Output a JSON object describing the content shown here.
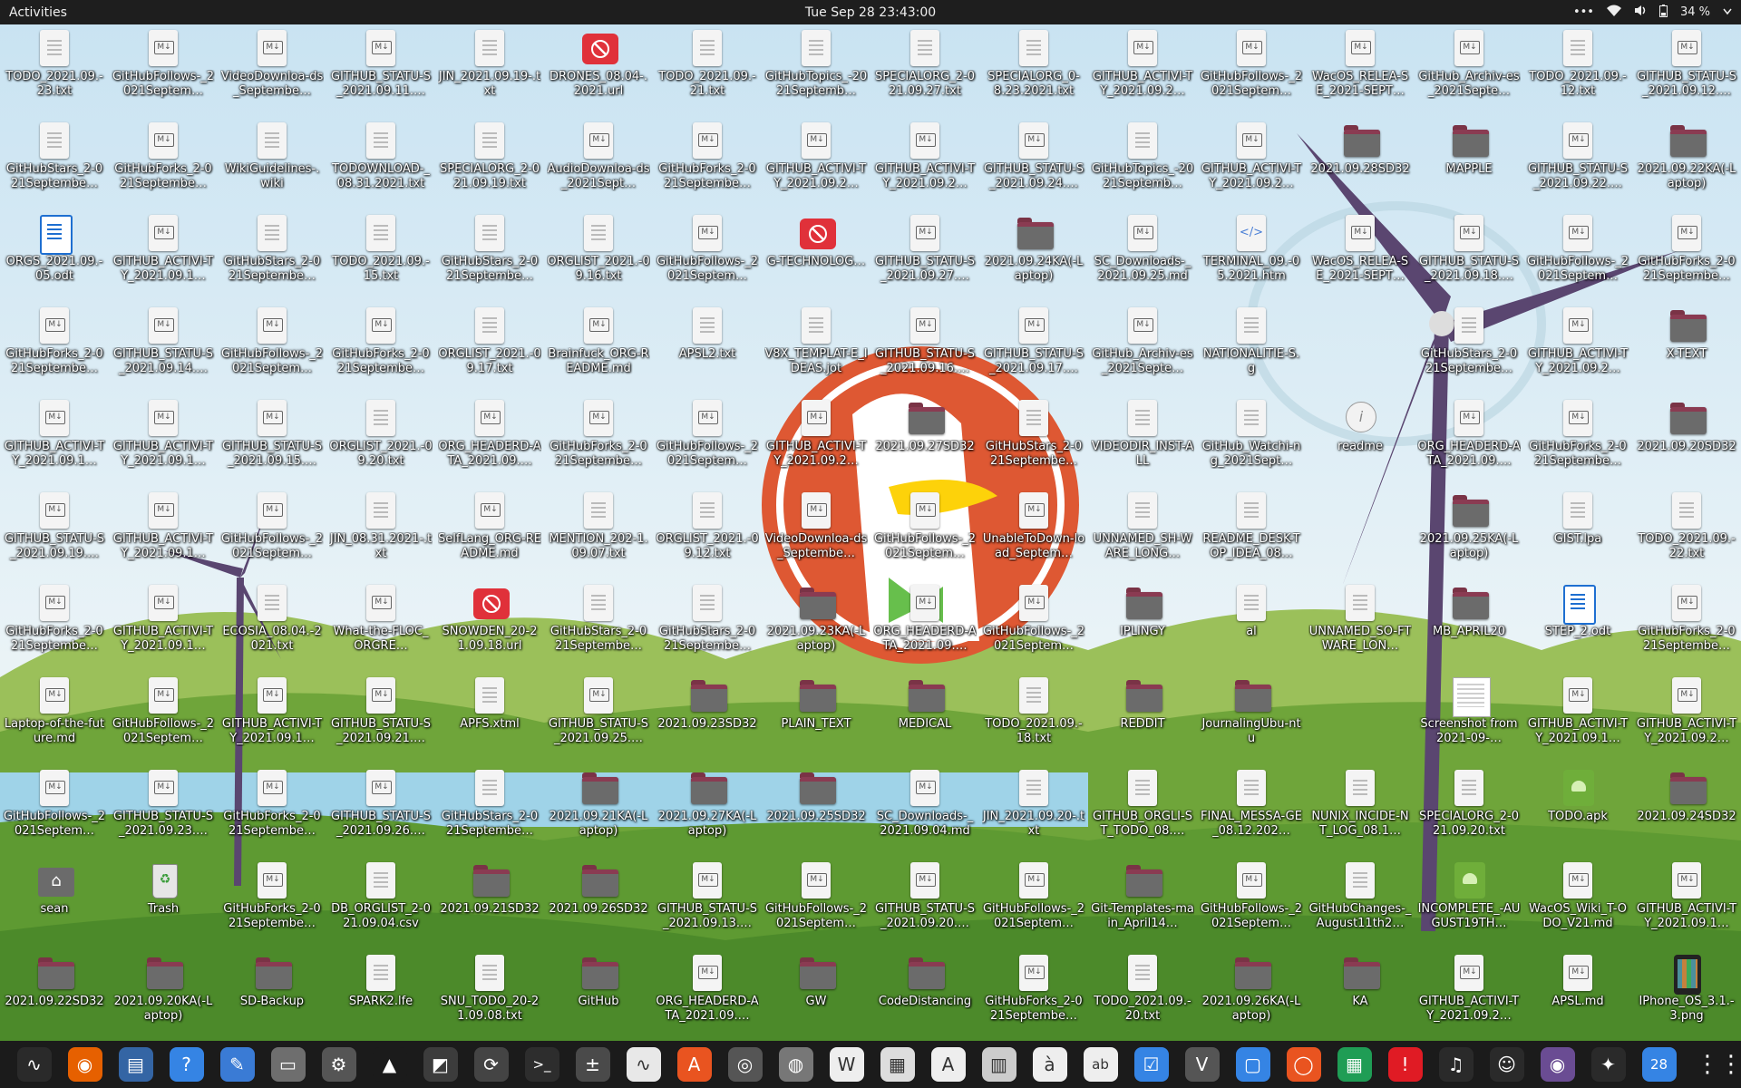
{
  "topbar": {
    "activities": "Activities",
    "clock": "Tue Sep 28  23:43:00",
    "menu_dots": "•••",
    "battery": "34 %",
    "icons": [
      "network-wifi-icon",
      "volume-icon",
      "battery-icon",
      "power-menu-icon"
    ]
  },
  "desktop": {
    "items": [
      {
        "label": "TODO_2021.09.-23.txt",
        "icon": "txt"
      },
      {
        "label": "GitHubFollows-_2021Septem…",
        "icon": "md"
      },
      {
        "label": "VideoDownloa-ds_Septembe…",
        "icon": "md"
      },
      {
        "label": "GITHUB_STATU-S_2021.09.11.…",
        "icon": "md"
      },
      {
        "label": "JIN_2021.09.19-.txt",
        "icon": "txt"
      },
      {
        "label": "DRONES_08.04-.2021.url",
        "icon": "url"
      },
      {
        "label": "TODO_2021.09.-21.txt",
        "icon": "txt"
      },
      {
        "label": "GitHubTopics_-2021Septemb…",
        "icon": "txt"
      },
      {
        "label": "SPECIALORG_2-021.09.27.txt",
        "icon": "txt"
      },
      {
        "label": "SPECIALORG_0-8.23.2021.txt",
        "icon": "txt"
      },
      {
        "label": "GITHUB_ACTIVI-TY_2021.09.2…",
        "icon": "md"
      },
      {
        "label": "GitHubFollows-_2021Septem…",
        "icon": "md"
      },
      {
        "label": "WacOS_RELEA-SE_2021-SEPT…",
        "icon": "md"
      },
      {
        "label": "GitHub_Archiv-es_2021Septe…",
        "icon": "md"
      },
      {
        "label": "TODO_2021.09.-12.txt",
        "icon": "txt"
      },
      {
        "label": "GITHUB_STATU-S_2021.09.12.…",
        "icon": "md"
      },
      {
        "label": "GitHubStars_2-021Septembe…",
        "icon": "txt"
      },
      {
        "label": "GitHubForks_2-021Septembe…",
        "icon": "md"
      },
      {
        "label": "WikiGuidelines-.wiki",
        "icon": "txt"
      },
      {
        "label": "TODOWNLOAD-_08.31.2021.txt",
        "icon": "txt"
      },
      {
        "label": "SPECIALORG_2-021.09.19.txt",
        "icon": "txt"
      },
      {
        "label": "AudioDownloa-ds_2021Sept…",
        "icon": "md"
      },
      {
        "label": "GitHubForks_2-021Septembe…",
        "icon": "md"
      },
      {
        "label": "GITHUB_ACTIVI-TY_2021.09.2…",
        "icon": "md"
      },
      {
        "label": "GITHUB_ACTIVI-TY_2021.09.2…",
        "icon": "md"
      },
      {
        "label": "GITHUB_STATU-S_2021.09.24.…",
        "icon": "md"
      },
      {
        "label": "GitHubTopics_-2021Septemb…",
        "icon": "txt"
      },
      {
        "label": "GITHUB_ACTIVI-TY_2021.09.2…",
        "icon": "md"
      },
      {
        "label": "2021.09.28SD32",
        "icon": "folder"
      },
      {
        "label": "MAPPLE",
        "icon": "folder"
      },
      {
        "label": "GITHUB_STATU-S_2021.09.22.…",
        "icon": "md"
      },
      {
        "label": "2021.09.22KA(-Laptop)",
        "icon": "folder"
      },
      {
        "label": "ORGS_2021.09.-05.odt",
        "icon": "odt"
      },
      {
        "label": "GITHUB_ACTIVI-TY_2021.09.1…",
        "icon": "md"
      },
      {
        "label": "GitHubStars_2-021Septembe…",
        "icon": "txt"
      },
      {
        "label": "TODO_2021.09.-15.txt",
        "icon": "txt"
      },
      {
        "label": "GitHubStars_2-021Septembe…",
        "icon": "txt"
      },
      {
        "label": "ORGLIST_2021.-09.16.txt",
        "icon": "txt"
      },
      {
        "label": "GitHubFollows-_2021Septem…",
        "icon": "md"
      },
      {
        "label": "G-TECHNOLOG…",
        "icon": "url"
      },
      {
        "label": "GITHUB_STATU-S_2021.09.27.…",
        "icon": "md"
      },
      {
        "label": "2021.09.24KA(-Laptop)",
        "icon": "folder"
      },
      {
        "label": "SC_Downloads-_2021.09.25.md",
        "icon": "md"
      },
      {
        "label": "TERMINAL_09.-05.2021.htm",
        "icon": "html"
      },
      {
        "label": "WacOS_RELEA-SE_2021-SEPT…",
        "icon": "md"
      },
      {
        "label": "GITHUB_STATU-S_2021.09.18.…",
        "icon": "md"
      },
      {
        "label": "GitHubFollows-_2021Septem…",
        "icon": "md"
      },
      {
        "label": "GitHubForks_2-021Septembe…",
        "icon": "md"
      },
      {
        "label": "GitHubForks_2-021Septembe…",
        "icon": "md"
      },
      {
        "label": "GITHUB_STATU-S_2021.09.14.…",
        "icon": "md"
      },
      {
        "label": "GitHubFollows-_2021Septem…",
        "icon": "md"
      },
      {
        "label": "GitHubForks_2-021Septembe…",
        "icon": "md"
      },
      {
        "label": "ORGLIST_2021.-09.17.txt",
        "icon": "txt"
      },
      {
        "label": "Brainfuck_ORG-README.md",
        "icon": "md"
      },
      {
        "label": "APSL2.txt",
        "icon": "txt"
      },
      {
        "label": "V8X_TEMPLAT-E_IDEAS.jot",
        "icon": "txt"
      },
      {
        "label": "GITHUB_STATU-S_2021.09.16.…",
        "icon": "md"
      },
      {
        "label": "GITHUB_STATU-S_2021.09.17.…",
        "icon": "md"
      },
      {
        "label": "GitHub_Archiv-es_2021Septe…",
        "icon": "md"
      },
      {
        "label": "NATIONALITIE-S.g",
        "icon": "txt"
      },
      {
        "label": "",
        "icon": "none"
      },
      {
        "label": "GitHubStars_2-021Septembe…",
        "icon": "txt"
      },
      {
        "label": "GITHUB_ACTIVI-TY_2021.09.2…",
        "icon": "md"
      },
      {
        "label": "X-TEXT",
        "icon": "folder"
      },
      {
        "label": "GITHUB_ACTIVI-TY_2021.09.1…",
        "icon": "md"
      },
      {
        "label": "GITHUB_ACTIVI-TY_2021.09.1…",
        "icon": "md"
      },
      {
        "label": "GITHUB_STATU-S_2021.09.15.…",
        "icon": "md"
      },
      {
        "label": "ORGLIST_2021.-09.20.txt",
        "icon": "txt"
      },
      {
        "label": "ORG_HEADERD-ATA_2021.09.…",
        "icon": "md"
      },
      {
        "label": "GitHubForks_2-021Septembe…",
        "icon": "md"
      },
      {
        "label": "GitHubFollows-_2021Septem…",
        "icon": "md"
      },
      {
        "label": "GITHUB_ACTIVI-TY_2021.09.2…",
        "icon": "md"
      },
      {
        "label": "2021.09.27SD32",
        "icon": "folder"
      },
      {
        "label": "GitHubStars_2-021Septembe…",
        "icon": "txt"
      },
      {
        "label": "VIDEODIR_INST-ALL",
        "icon": "txt"
      },
      {
        "label": "GitHub_Watchi-ng_2021Sept…",
        "icon": "txt"
      },
      {
        "label": "readme",
        "icon": "info"
      },
      {
        "label": "ORG_HEADERD-ATA_2021.09.…",
        "icon": "md"
      },
      {
        "label": "GitHubForks_2-021Septembe…",
        "icon": "md"
      },
      {
        "label": "2021.09.20SD32",
        "icon": "folder"
      },
      {
        "label": "GITHUB_STATU-S_2021.09.19.…",
        "icon": "md"
      },
      {
        "label": "GITHUB_ACTIVI-TY_2021.09.1…",
        "icon": "md"
      },
      {
        "label": "GitHubFollows-_2021Septem…",
        "icon": "md"
      },
      {
        "label": "JIN_08.31.2021-.txt",
        "icon": "txt"
      },
      {
        "label": "SelfLang_ORG-README.md",
        "icon": "md"
      },
      {
        "label": "MENTION_202-1.09.07.txt",
        "icon": "txt"
      },
      {
        "label": "ORGLIST_2021.-09.12.txt",
        "icon": "txt"
      },
      {
        "label": "VideoDownloa-ds_Septembe…",
        "icon": "md"
      },
      {
        "label": "GitHubFollows-_2021Septem…",
        "icon": "md"
      },
      {
        "label": "UnableToDown-load_Septem…",
        "icon": "md"
      },
      {
        "label": "UNNAMED_SH-WARE_LONG…",
        "icon": "txt"
      },
      {
        "label": "README_DESK-TOP_IDEA_08…",
        "icon": "txt"
      },
      {
        "label": "",
        "icon": "none"
      },
      {
        "label": "2021.09.25KA(-Laptop)",
        "icon": "folder"
      },
      {
        "label": "GIST.lpa",
        "icon": "txt"
      },
      {
        "label": "TODO_2021.09.-22.txt",
        "icon": "txt"
      },
      {
        "label": "GitHubForks_2-021Septembe…",
        "icon": "md"
      },
      {
        "label": "GITHUB_ACTIVI-TY_2021.09.1…",
        "icon": "md"
      },
      {
        "label": "ECOSIA_08.04.-2021.txt",
        "icon": "txt"
      },
      {
        "label": "What-the-FLOC_ORGRE…",
        "icon": "md"
      },
      {
        "label": "SNOWDEN_20-21.09.18.url",
        "icon": "url"
      },
      {
        "label": "GitHubStars_2-021Septembe…",
        "icon": "txt"
      },
      {
        "label": "GitHubStars_2-021Septembe…",
        "icon": "txt"
      },
      {
        "label": "2021.09.23KA(-Laptop)",
        "icon": "folder"
      },
      {
        "label": "ORG_HEADERD-ATA_2021.09.…",
        "icon": "md"
      },
      {
        "label": "GitHubFollows-_2021Septem…",
        "icon": "md"
      },
      {
        "label": "IPLINGY",
        "icon": "folder"
      },
      {
        "label": "al",
        "icon": "txt"
      },
      {
        "label": "UNNAMED_SO-FTWARE_LON…",
        "icon": "txt"
      },
      {
        "label": "MB_APRIL20",
        "icon": "folder"
      },
      {
        "label": "STEP_2.odt",
        "icon": "odt"
      },
      {
        "label": "GitHubForks_2-021Septembe…",
        "icon": "md"
      },
      {
        "label": "Laptop-of-the-future.md",
        "icon": "md"
      },
      {
        "label": "GitHubFollows-_2021Septem…",
        "icon": "md"
      },
      {
        "label": "GITHUB_ACTIVI-TY_2021.09.1…",
        "icon": "md"
      },
      {
        "label": "GITHUB_STATU-S_2021.09.21.…",
        "icon": "md"
      },
      {
        "label": "APFS.xtml",
        "icon": "txt"
      },
      {
        "label": "GITHUB_STATU-S_2021.09.25.…",
        "icon": "md"
      },
      {
        "label": "2021.09.23SD32",
        "icon": "folder"
      },
      {
        "label": "PLAIN_TEXT",
        "icon": "folder"
      },
      {
        "label": "MEDICAL",
        "icon": "folder"
      },
      {
        "label": "TODO_2021.09.-18.txt",
        "icon": "txt"
      },
      {
        "label": "REDDIT",
        "icon": "folder"
      },
      {
        "label": "JournalingUbu-ntu",
        "icon": "folder"
      },
      {
        "label": "",
        "icon": "none"
      },
      {
        "label": "Screenshot from 2021-09-…",
        "icon": "shot"
      },
      {
        "label": "GITHUB_ACTIVI-TY_2021.09.1…",
        "icon": "md"
      },
      {
        "label": "GITHUB_ACTIVI-TY_2021.09.2…",
        "icon": "md"
      },
      {
        "label": "GitHubFollows-_2021Septem…",
        "icon": "md"
      },
      {
        "label": "GITHUB_STATU-S_2021.09.23.…",
        "icon": "md"
      },
      {
        "label": "GitHubForks_2-021Septembe…",
        "icon": "md"
      },
      {
        "label": "GITHUB_STATU-S_2021.09.26.…",
        "icon": "md"
      },
      {
        "label": "GitHubStars_2-021Septembe…",
        "icon": "txt"
      },
      {
        "label": "2021.09.21KA(-Laptop)",
        "icon": "folder"
      },
      {
        "label": "2021.09.27KA(-Laptop)",
        "icon": "folder"
      },
      {
        "label": "2021.09.25SD32",
        "icon": "folder"
      },
      {
        "label": "SC_Downloads-_2021.09.04.md",
        "icon": "md"
      },
      {
        "label": "JIN_2021.09.20-.txt",
        "icon": "txt"
      },
      {
        "label": "GITHUB_ORGLI-ST_TODO_08.…",
        "icon": "txt"
      },
      {
        "label": "FINAL_MESSA-GE_08.12.202…",
        "icon": "txt"
      },
      {
        "label": "NUNIX_INCIDE-NT_LOG_08.1…",
        "icon": "txt"
      },
      {
        "label": "SPECIALORG_2-021.09.20.txt",
        "icon": "txt"
      },
      {
        "label": "TODO.apk",
        "icon": "apk"
      },
      {
        "label": "2021.09.24SD32",
        "icon": "folder"
      },
      {
        "label": "sean",
        "icon": "home"
      },
      {
        "label": "Trash",
        "icon": "trash"
      },
      {
        "label": "GitHubForks_2-021Septembe…",
        "icon": "md"
      },
      {
        "label": "DB_ORGLIST_2-021.09.04.csv",
        "icon": "txt"
      },
      {
        "label": "2021.09.21SD32",
        "icon": "folder"
      },
      {
        "label": "2021.09.26SD32",
        "icon": "folder"
      },
      {
        "label": "GITHUB_STATU-S_2021.09.13.…",
        "icon": "md"
      },
      {
        "label": "GitHubFollows-_2021Septem…",
        "icon": "md"
      },
      {
        "label": "GITHUB_STATU-S_2021.09.20.…",
        "icon": "md"
      },
      {
        "label": "GitHubFollows-_2021Septem…",
        "icon": "md"
      },
      {
        "label": "Git-Templates-main_April14…",
        "icon": "folder"
      },
      {
        "label": "GitHubFollows-_2021Septem…",
        "icon": "md"
      },
      {
        "label": "GitHubChanges-_August11th2…",
        "icon": "txt"
      },
      {
        "label": "INCOMPLETE_-AUGUST19TH…",
        "icon": "apk"
      },
      {
        "label": "WacOS_Wiki_T-ODO_V21.md",
        "icon": "md"
      },
      {
        "label": "GITHUB_ACTIVI-TY_2021.09.1…",
        "icon": "md"
      },
      {
        "label": "2021.09.22SD32",
        "icon": "folder"
      },
      {
        "label": "2021.09.20KA(-Laptop)",
        "icon": "folder"
      },
      {
        "label": "SD-Backup",
        "icon": "folder"
      },
      {
        "label": "SPARK2.lfe",
        "icon": "txt"
      },
      {
        "label": "SNU_TODO_20-21.09.08.txt",
        "icon": "txt"
      },
      {
        "label": "GitHub",
        "icon": "folder"
      },
      {
        "label": "ORG_HEADERD-ATA_2021.09.…",
        "icon": "md"
      },
      {
        "label": "GW",
        "icon": "folder"
      },
      {
        "label": "CodeDistancing",
        "icon": "folder"
      },
      {
        "label": "GitHubForks_2-021Septembe…",
        "icon": "md"
      },
      {
        "label": "TODO_2021.09.-20.txt",
        "icon": "txt"
      },
      {
        "label": "2021.09.26KA(-Laptop)",
        "icon": "folder"
      },
      {
        "label": "KA",
        "icon": "folder"
      },
      {
        "label": "GITHUB_ACTIVI-TY_2021.09.2…",
        "icon": "md"
      },
      {
        "label": "APSL.md",
        "icon": "md"
      },
      {
        "label": "IPhone_OS_3.1.-3.png",
        "icon": "phone"
      }
    ]
  },
  "dock": {
    "items": [
      {
        "name": "system-monitor-icon",
        "bg": "#2a2a2a",
        "glyph": "∿"
      },
      {
        "name": "firefox-icon",
        "bg": "#e66000",
        "glyph": "◉"
      },
      {
        "name": "document-viewer-icon",
        "bg": "#3465a4",
        "glyph": "▤"
      },
      {
        "name": "help-icon",
        "bg": "#3584e4",
        "glyph": "?"
      },
      {
        "name": "text-editor-icon",
        "bg": "#3a7bd5",
        "glyph": "✎"
      },
      {
        "name": "files-icon",
        "bg": "#6e6e6e",
        "glyph": "▭"
      },
      {
        "name": "settings-icon",
        "bg": "#555555",
        "glyph": "⚙"
      },
      {
        "name": "vlc-icon",
        "bg": "#1b1b1b",
        "glyph": "▲"
      },
      {
        "name": "image-editor-icon",
        "bg": "#3c3c3c",
        "glyph": "◩"
      },
      {
        "name": "software-updater-icon",
        "bg": "#444444",
        "glyph": "⟳"
      },
      {
        "name": "terminal-icon",
        "bg": "#2d2d2d",
        "glyph": ">_"
      },
      {
        "name": "calculator-icon",
        "bg": "#4a4a4a",
        "glyph": "±"
      },
      {
        "name": "system-monitor-graph-icon",
        "bg": "#e8e8e8",
        "glyph": "∿"
      },
      {
        "name": "app-store-icon",
        "bg": "#e95420",
        "glyph": "A"
      },
      {
        "name": "screenshot-icon",
        "bg": "#555555",
        "glyph": "◎"
      },
      {
        "name": "disks-icon",
        "bg": "#777777",
        "glyph": "◍"
      },
      {
        "name": "wikipedia-icon",
        "bg": "#eeeeee",
        "glyph": "W"
      },
      {
        "name": "reader-icon",
        "bg": "#dddddd",
        "glyph": "▦"
      },
      {
        "name": "font-viewer-icon",
        "bg": "#eeeeee",
        "glyph": "A"
      },
      {
        "name": "archive-manager-icon",
        "bg": "#cccccc",
        "glyph": "▥"
      },
      {
        "name": "character-map-icon",
        "bg": "#eeeeee",
        "glyph": "à"
      },
      {
        "name": "dictionary-icon",
        "bg": "#eeeeee",
        "glyph": "ab"
      },
      {
        "name": "todo-icon",
        "bg": "#3584e4",
        "glyph": "☑"
      },
      {
        "name": "vim-icon",
        "bg": "#555555",
        "glyph": "V"
      },
      {
        "name": "remote-desktop-icon",
        "bg": "#3584e4",
        "glyph": "▢"
      },
      {
        "name": "ubuntu-icon",
        "bg": "#e95420",
        "glyph": "◯"
      },
      {
        "name": "spreadsheet-icon",
        "bg": "#1f9d55",
        "glyph": "▦"
      },
      {
        "name": "alert-icon",
        "bg": "#e01b24",
        "glyph": "!"
      },
      {
        "name": "music-icon",
        "bg": "#2a2a2a",
        "glyph": "♫"
      },
      {
        "name": "game-icon",
        "bg": "#2a2a2a",
        "glyph": "☺"
      },
      {
        "name": "cheese-camera-icon",
        "bg": "#6a4c93",
        "glyph": "◉"
      },
      {
        "name": "satellite-icon",
        "bg": "#2a2a2a",
        "glyph": "✦"
      },
      {
        "name": "calendar-icon",
        "bg": "#3584e4",
        "glyph": "28"
      }
    ],
    "apps_grid_icon": "show-applications-icon"
  }
}
